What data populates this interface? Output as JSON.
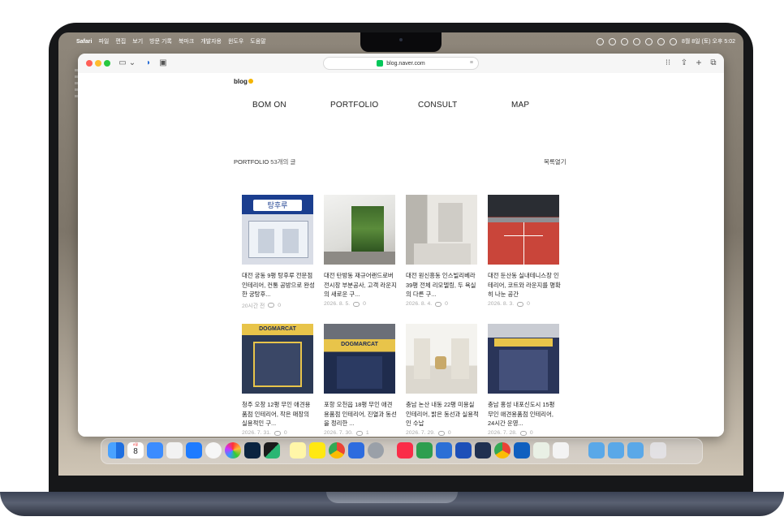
{
  "menubar": {
    "app_name": "Safari",
    "menus": [
      "파일",
      "편집",
      "보기",
      "방문 기록",
      "북마크",
      "개발자용",
      "윈도우",
      "도움말"
    ],
    "datetime": "8월 8일 (토) 오후 5:02"
  },
  "browser": {
    "url": "blog.naver.com"
  },
  "blog": {
    "logo": "blog",
    "nav": [
      "BOM ON",
      "PORTFOLIO",
      "CONSULT",
      "MAP"
    ],
    "category_label": "PORTFOLIO",
    "post_count": "53개의 글",
    "toggle_list": "목록열기"
  },
  "posts": [
    {
      "title": "대전 궁동 9평 탕후루 전문점 인테리어, 컨통 공방으로 완성한 궁탕후...",
      "date": "20시간 전",
      "comments": "0"
    },
    {
      "title": "대전 탄방동 재규어랜드로버 전시장 부분공사, 고객 라운지의 새로운 구...",
      "date": "2026. 8. 5.",
      "comments": "0"
    },
    {
      "title": "대전 원신흥동 인스빌리베라 39평 전체 리모델링, 두 욕실의 다른 구...",
      "date": "2026. 8. 4.",
      "comments": "0"
    },
    {
      "title": "대전 둔산동 실내테니스장 인테리어, 코트와 라운지를 명확히 나눈 공간",
      "date": "2026. 8. 3.",
      "comments": "0"
    },
    {
      "title": "청주 오창 12평 무인 애견용품점 인테리어, 작은 매장의 실용적인 구...",
      "date": "2026. 7. 31.",
      "comments": "0"
    },
    {
      "title": "포항 오천읍 18평 무인 애견용품점 인테리어, 진열과 동선을 정리한 ...",
      "date": "2026. 7. 30.",
      "comments": "1"
    },
    {
      "title": "충남 논산 내동 22평 미용실 인테리어, 밝은 동선과 실용적인 수납",
      "date": "2026. 7. 29.",
      "comments": "0"
    },
    {
      "title": "충남 홍성 내포신도시 15평 무인 애견용품점 인테리어, 24시간 운영...",
      "date": "2026. 7. 28.",
      "comments": "0"
    }
  ],
  "thumb_signs": {
    "dog_store": "DOGMARCAT",
    "tanghulu": "탕후루"
  },
  "dock_badges": {
    "calendar_month": "8월",
    "calendar_day": "8"
  }
}
